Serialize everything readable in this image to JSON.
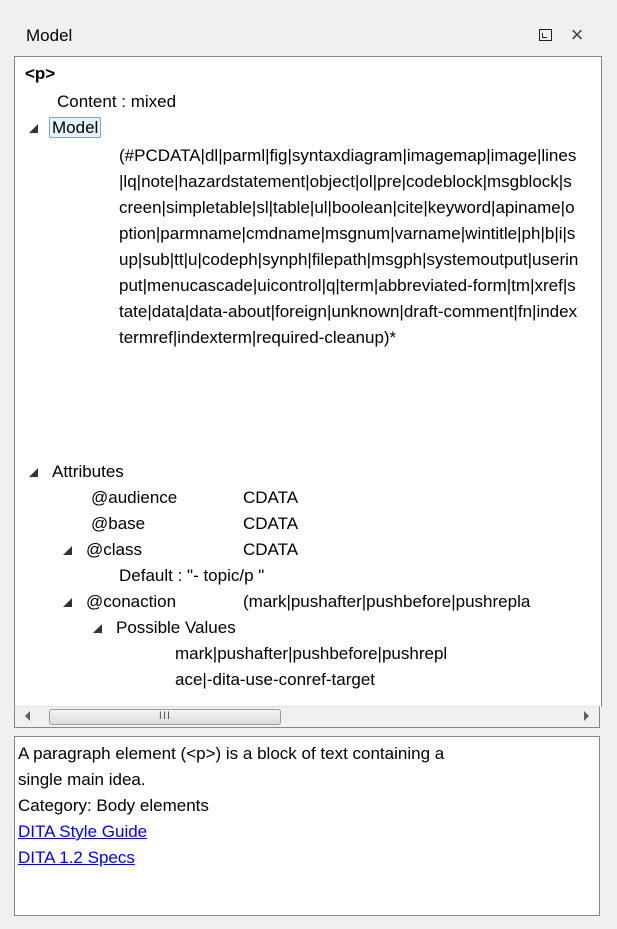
{
  "titlebar": {
    "title": "Model",
    "restore_label": "",
    "close_label": "×"
  },
  "tree": {
    "element_name": "<p>",
    "content": "Content : mixed",
    "model_label": "Model",
    "model_value": "(#PCDATA|dl|parml|fig|syntaxdiagram|imagemap|image|lines|lq|note|hazardstatement|object|ol|pre|codeblock|msgblock|screen|simpletable|sl|table|ul|boolean|cite|keyword|apiname|option|parmname|cmdname|msgnum|varname|wintitle|ph|b|i|sup|sub|tt|u|codeph|synph|filepath|msgph|systemoutput|userinput|menucascade|uicontrol|q|term|abbreviated-form|tm|xref|state|data|data-about|foreign|unknown|draft-comment|fn|indextermref|indexterm|required-cleanup)*",
    "attributes_label": "Attributes",
    "attributes": [
      {
        "name": "@audience",
        "type": "CDATA"
      },
      {
        "name": "@base",
        "type": "CDATA"
      },
      {
        "name": "@class",
        "type": "CDATA"
      },
      {
        "name": "@conaction",
        "type": "(mark|pushafter|pushbefore|pushrepla"
      }
    ],
    "class_default": "Default : \"- topic/p \"",
    "possible_values_label": "Possible Values",
    "possible_values_line1": "mark|pushafter|pushbefore|pushrepl",
    "possible_values_line2": "ace|-dita-use-conref-target"
  },
  "scrollbar": {
    "thumb_grip": "III"
  },
  "description": {
    "line1": "A paragraph element (<p>) is a block of text containing a",
    "line2": "single main idea.",
    "category": "Category: Body elements",
    "link1": "DITA Style Guide",
    "link2": "DITA 1.2 Specs"
  }
}
